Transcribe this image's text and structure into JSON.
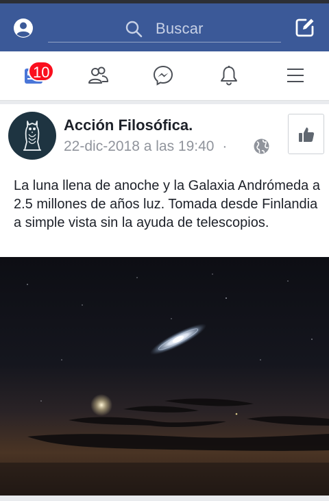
{
  "search": {
    "placeholder": "Buscar"
  },
  "nav": {
    "notifications_badge": "10"
  },
  "post": {
    "page_name": "Acción Filosófica.",
    "timestamp": "22-dic-2018 a las 19:40",
    "separator": "·",
    "text": "La luna llena de anoche y la Galaxia Andrómeda a 2.5 millones de años luz. Tomada desde Finlandia a simple vista sin la ayuda de telescopios."
  },
  "colors": {
    "header_blue": "#3b5998",
    "badge_red": "#fa0f1e",
    "text_dark": "#1d2129",
    "meta_gray": "#90949c"
  },
  "icons": [
    "profile-icon",
    "search-icon",
    "compose-icon",
    "news-feed-icon",
    "friends-icon",
    "messenger-icon",
    "bell-icon",
    "menu-icon",
    "globe-icon",
    "thumbs-up-icon",
    "owl-logo-icon"
  ]
}
